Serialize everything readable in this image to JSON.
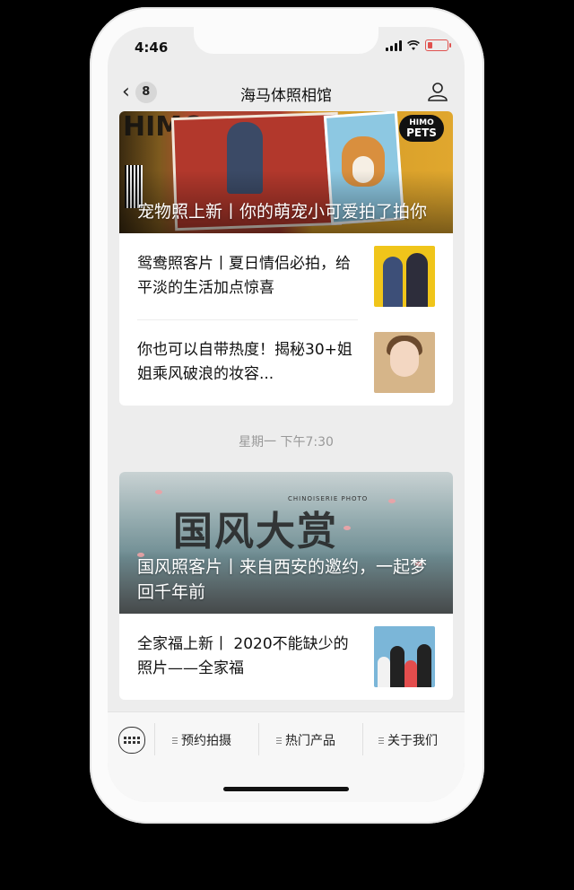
{
  "status": {
    "time": "4:46"
  },
  "nav": {
    "back_count": "8",
    "title": "海马体照相馆"
  },
  "group1": {
    "hero_title": "宠物照上新丨你的萌宠小可爱拍了拍你",
    "hero_logo_top": "HIMO",
    "hero_logo_bottom": "PETS",
    "hero_left_text": "HIMO",
    "items": [
      {
        "text": "鸳鸯照客片丨夏日情侣必拍，给平淡的生活加点惊喜"
      },
      {
        "text": "你也可以自带热度！揭秘30+姐姐乘风破浪的妆容..."
      }
    ]
  },
  "timestamp": "星期一 下午7:30",
  "group2": {
    "hero_title": "国风照客片丨来自西安的邀约，一起梦回千年前",
    "calligraphy": "国风大赏",
    "calligraphy_small": "CHINOISERIE PHOTO",
    "items": [
      {
        "text": "全家福上新丨 2020不能缺少的照片——全家福"
      }
    ]
  },
  "menus": [
    {
      "label": "预约拍摄"
    },
    {
      "label": "热门产品"
    },
    {
      "label": "关于我们"
    }
  ],
  "colors": {
    "accent_red": "#e0524f",
    "background": "#ededed"
  }
}
